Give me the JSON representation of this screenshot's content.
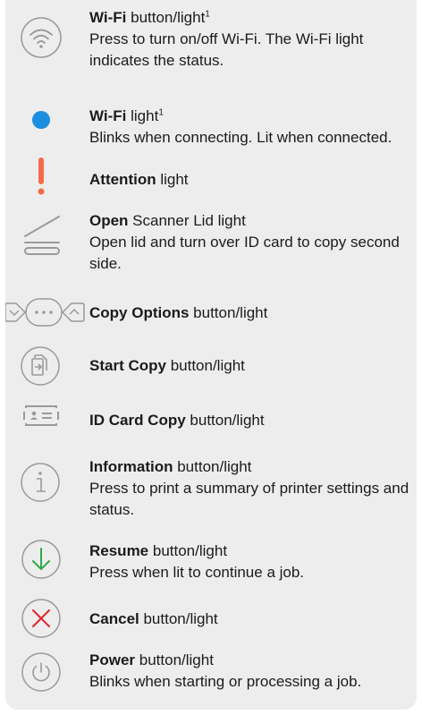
{
  "footnote_mark": "1",
  "items": [
    {
      "bold": "Wi-Fi",
      "rest": " button/light",
      "sup": true,
      "desc": "Press to turn on/off Wi-Fi. The Wi-Fi light indicates the status.",
      "icon": "wifi-icon"
    },
    {
      "bold": "Wi-Fi",
      "rest": " light",
      "sup": true,
      "desc": "Blinks when connecting. Lit when connected.",
      "icon": "wifi-status-dot-icon",
      "color": "#1a8fe0"
    },
    {
      "bold": "Attention",
      "rest": " light",
      "sup": false,
      "desc": "",
      "icon": "attention-exclamation-icon",
      "color": "#f26b4a"
    },
    {
      "bold": "Open",
      "rest": " Scanner Lid light",
      "sup": false,
      "desc": "Open lid and turn over ID card to copy second side.",
      "icon": "open-scanner-lid-icon"
    },
    {
      "bold": "Copy Options",
      "rest": " button/light",
      "sup": false,
      "desc": "",
      "icon": "copy-options-icon"
    },
    {
      "bold": "Start Copy",
      "rest": " button/light",
      "sup": false,
      "desc": "",
      "icon": "start-copy-icon"
    },
    {
      "bold": "ID Card Copy",
      "rest": " button/light",
      "sup": false,
      "desc": "",
      "icon": "id-card-icon"
    },
    {
      "bold": "Information",
      "rest": " button/light",
      "sup": false,
      "desc": "Press to print a summary of printer settings and status.",
      "icon": "information-icon"
    },
    {
      "bold": "Resume",
      "rest": " button/light",
      "sup": false,
      "desc": "Press when lit to continue a job.",
      "icon": "resume-arrow-icon",
      "color": "#2eaa4a"
    },
    {
      "bold": "Cancel",
      "rest": " button/light",
      "sup": false,
      "desc": "",
      "icon": "cancel-x-icon",
      "color": "#e0242f"
    },
    {
      "bold": "Power",
      "rest": " button/light",
      "sup": false,
      "desc": "Blinks when starting or processing a job.",
      "icon": "power-icon"
    }
  ]
}
